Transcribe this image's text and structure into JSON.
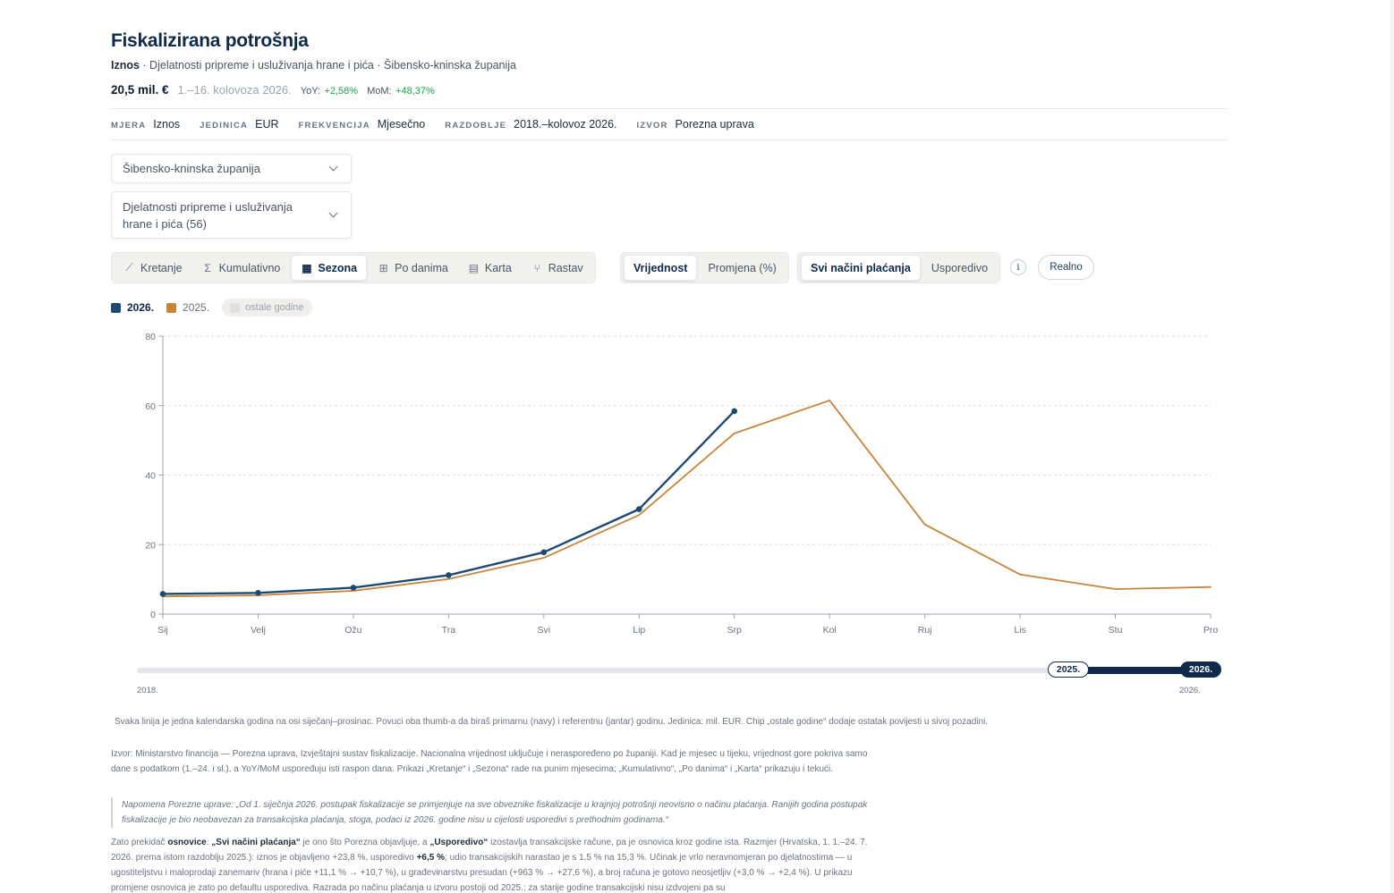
{
  "header": {
    "title": "Fiskalizirana potrošnja",
    "subtitle_measure": "Iznos",
    "subtitle_rest": " · Djelatnosti pripreme i usluživanja hrane i pića · Šibensko-kninska županija",
    "value": "20,5 mil. €",
    "period": "1.–16. kolovoza 2026.",
    "yoy_label": "YoY:",
    "yoy_value": "+2,58%",
    "mom_label": "MoM:",
    "mom_value": "+48,37%"
  },
  "meta": [
    {
      "key": "MJERA",
      "value": "Iznos"
    },
    {
      "key": "JEDINICA",
      "value": "EUR"
    },
    {
      "key": "FREKVENCIJA",
      "value": "Mjesečno"
    },
    {
      "key": "RAZDOBLJE",
      "value": "2018.–kolovoz 2026."
    },
    {
      "key": "IZVOR",
      "value": "Porezna uprava"
    }
  ],
  "filters": {
    "region": "Šibensko-kninska županija",
    "activity": "Djelatnosti pripreme i usluživanja hrane i pića (56)"
  },
  "view_tabs": [
    {
      "label": "Kretanje",
      "icon": "line-chart-icon",
      "glyph": "⟋"
    },
    {
      "label": "Kumulativno",
      "icon": "sigma-icon",
      "glyph": "Σ"
    },
    {
      "label": "Sezona",
      "icon": "calendar-icon",
      "glyph": "▦",
      "active": true
    },
    {
      "label": "Po danima",
      "icon": "grid-icon",
      "glyph": "⊞"
    },
    {
      "label": "Karta",
      "icon": "map-icon",
      "glyph": "▤"
    },
    {
      "label": "Rastav",
      "icon": "split-icon",
      "glyph": "⑂"
    }
  ],
  "value_tabs": [
    {
      "label": "Vrijednost",
      "active": true
    },
    {
      "label": "Promjena (%)"
    }
  ],
  "payment_tabs": [
    {
      "label": "Svi načini plaćanja",
      "active": true
    },
    {
      "label": "Usporedivo"
    }
  ],
  "info_glyph": "i",
  "realno_label": "Realno",
  "legend": {
    "primary": "2026.",
    "reference": "2025.",
    "others": "ostale godine"
  },
  "colors": {
    "primary": "#1c4a72",
    "reference": "#c8853a",
    "grid": "#d9dde2",
    "axis": "#6b7280"
  },
  "chart_data": {
    "type": "line",
    "categories": [
      "Sij",
      "Velj",
      "Ožu",
      "Tra",
      "Svi",
      "Lip",
      "Srp",
      "Kol",
      "Ruj",
      "Lis",
      "Stu",
      "Pro"
    ],
    "series": [
      {
        "name": "2026.",
        "values": [
          5.8,
          6.1,
          7.6,
          11.2,
          17.8,
          30.2,
          58.4,
          null,
          null,
          null,
          null,
          null
        ]
      },
      {
        "name": "2025.",
        "values": [
          5.1,
          5.4,
          6.7,
          10.1,
          16.2,
          28.5,
          52.0,
          61.5,
          25.8,
          11.4,
          7.2,
          7.8
        ]
      }
    ],
    "yticks": [
      "0",
      "20",
      "40",
      "60",
      "80"
    ],
    "ylim": [
      0,
      80
    ],
    "grid": true,
    "legend_position": "top-left"
  },
  "slider": {
    "min_label": "2018.",
    "max_label": "2026.",
    "reference_label": "2025.",
    "primary_label": "2026."
  },
  "notes": {
    "caption": "Svaka linija je jedna kalendarska godina na osi siječanj–prosinac. Povuci oba thumb-a da biraš primarnu (navy) i referentnu (jantar) godinu. Jedinica: mil. EUR. Chip „ostale godine“ dodaje ostatak povijesti u sivoj pozadini.",
    "source": "Izvor: Ministarstvo financija — Porezna uprava, Izvještajni sustav fiskalizacije. Nacionalna vrijednost uključuje i neraspoređeno po županiji. Kad je mjesec u tijeku, vrijednost gore pokriva samo dane s podatkom (1.–24. i sl.), a YoY/MoM uspoređuju isti raspon dana. Prikazi „Kretanje“ i „Sezona“ rade na punim mjesecima; „Kumulativno“, „Po danima“ i „Karta“ prikazuju i tekući.",
    "quote": "Napomena Porezne uprave: „Od 1. siječnja 2026. postupak fiskalizacije se primjenjuje na sve obveznike fiskalizacije u krajnjoj potrošnji neovisno o načinu plaćanja. Ranijih godina postupak fiskalizacije je bio neobavezan za transakcijska plaćanja, stoga, podaci iz 2026. godine nisu u cijelosti usporedivi s prethodnim godinama.“",
    "explain_1": "Zato prekidač ",
    "explain_b1": "osnovice",
    "explain_2": ": ",
    "explain_b2": "„Svi načini plaćanja“",
    "explain_3": " je ono što Porezna objavljuje, a ",
    "explain_b3": "„Usporedivo“",
    "explain_4": " izostavlja transakcijske račune, pa je osnovica kroz godine ista. Razmjer (Hrvatska, 1. 1.–24. 7. 2026. prema istom razdoblju 2025.): iznos je objavljeno +23,8 %, usporedivo ",
    "explain_b4": "+6,5 %",
    "explain_5": "; udio transakcijskih narastao je s 1,5 % na 15,3 %. Učinak je vrlo neravnomjeran po djelatnostima — u ugostiteljstvu i maloprodaji zanemariv (hrana i piće +11,1 % → +10,7 %), u građevinarstvu presudan (+963 % → +27,6 %), a broj računa je gotovo neosjetljiv (+3,0 % → +2,4 %). U prikazu promjene osnovica je zato po defaultu usporediva. Razrada po načinu plaćanja u izvoru postoji od 2025.; za starije godine transakcijski nisu izdvojeni pa su"
  }
}
